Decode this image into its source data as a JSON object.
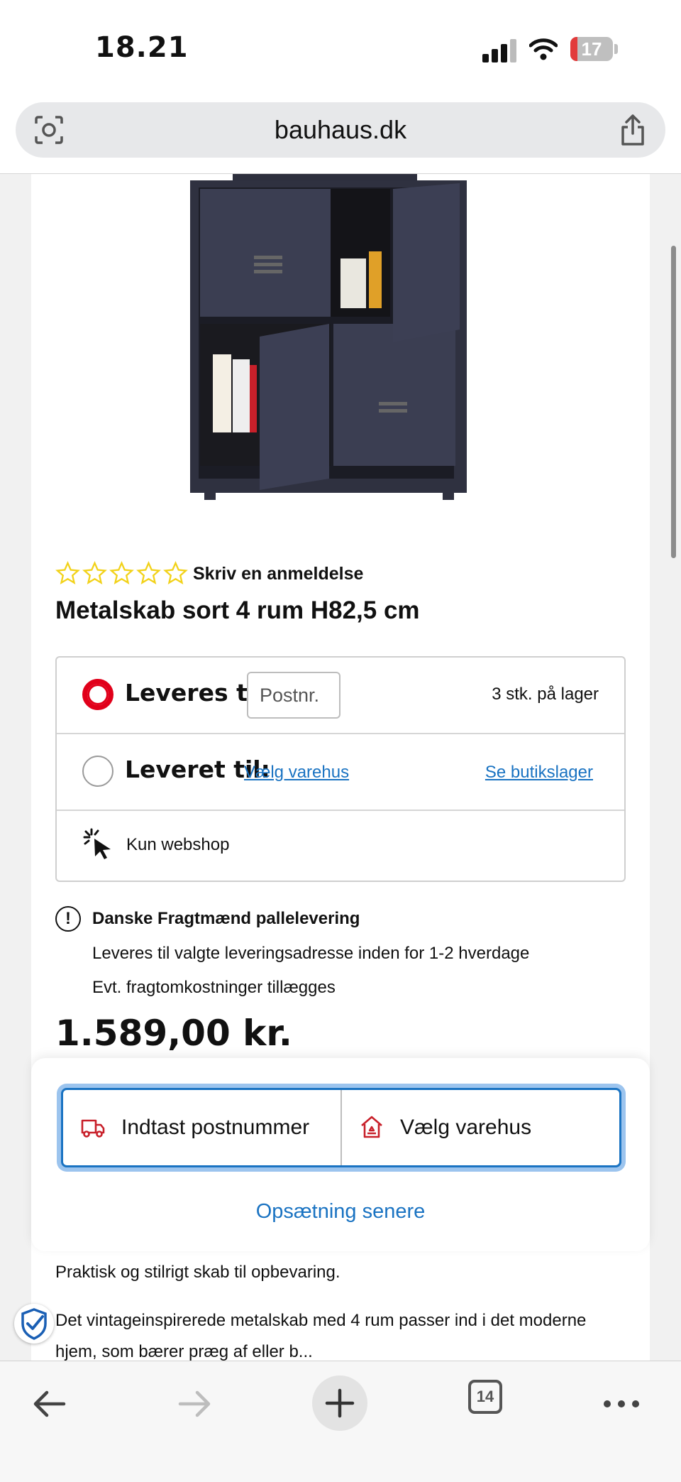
{
  "status_bar": {
    "time": "18.21",
    "battery": "17",
    "battery_level": 0.17
  },
  "browser": {
    "url": "bauhaus.dk",
    "tab_count": "14"
  },
  "product": {
    "review_link": "Skriv en anmeldelse",
    "rating_stars": 0,
    "title": "Metalskab sort 4 rum H82,5 cm",
    "price": "1.589,00 kr.",
    "description_short": "Praktisk og stilrigt skab til opbevaring.",
    "description_long": "Det vintageinspirerede metalskab med 4 rum passer ind i det moderne hjem, som bærer præg af eller b..."
  },
  "delivery": {
    "deliver_label": "Leveres til:",
    "postcode_placeholder": "Postnr.",
    "stock": "3 stk. på lager",
    "pickup_label": "Leveret til:",
    "choose_store": "Vælg varehus",
    "see_store_stock": "Se butikslager",
    "webshop_only": "Kun webshop"
  },
  "shipping_info": {
    "title": "Danske Fragtmænd pallelevering",
    "line1": "Leveres til valgte leveringsadresse inden for 1-2 hverdage",
    "line2": "Evt. fragtomkostninger tillægges"
  },
  "sheet": {
    "enter_postcode": "Indtast postnummer",
    "choose_store": "Vælg varehus",
    "setup_later": "Opsætning senere"
  },
  "colors": {
    "accent_red": "#e1001a",
    "link_blue": "#1a73c2",
    "star_yellow": "#f2d21a"
  }
}
